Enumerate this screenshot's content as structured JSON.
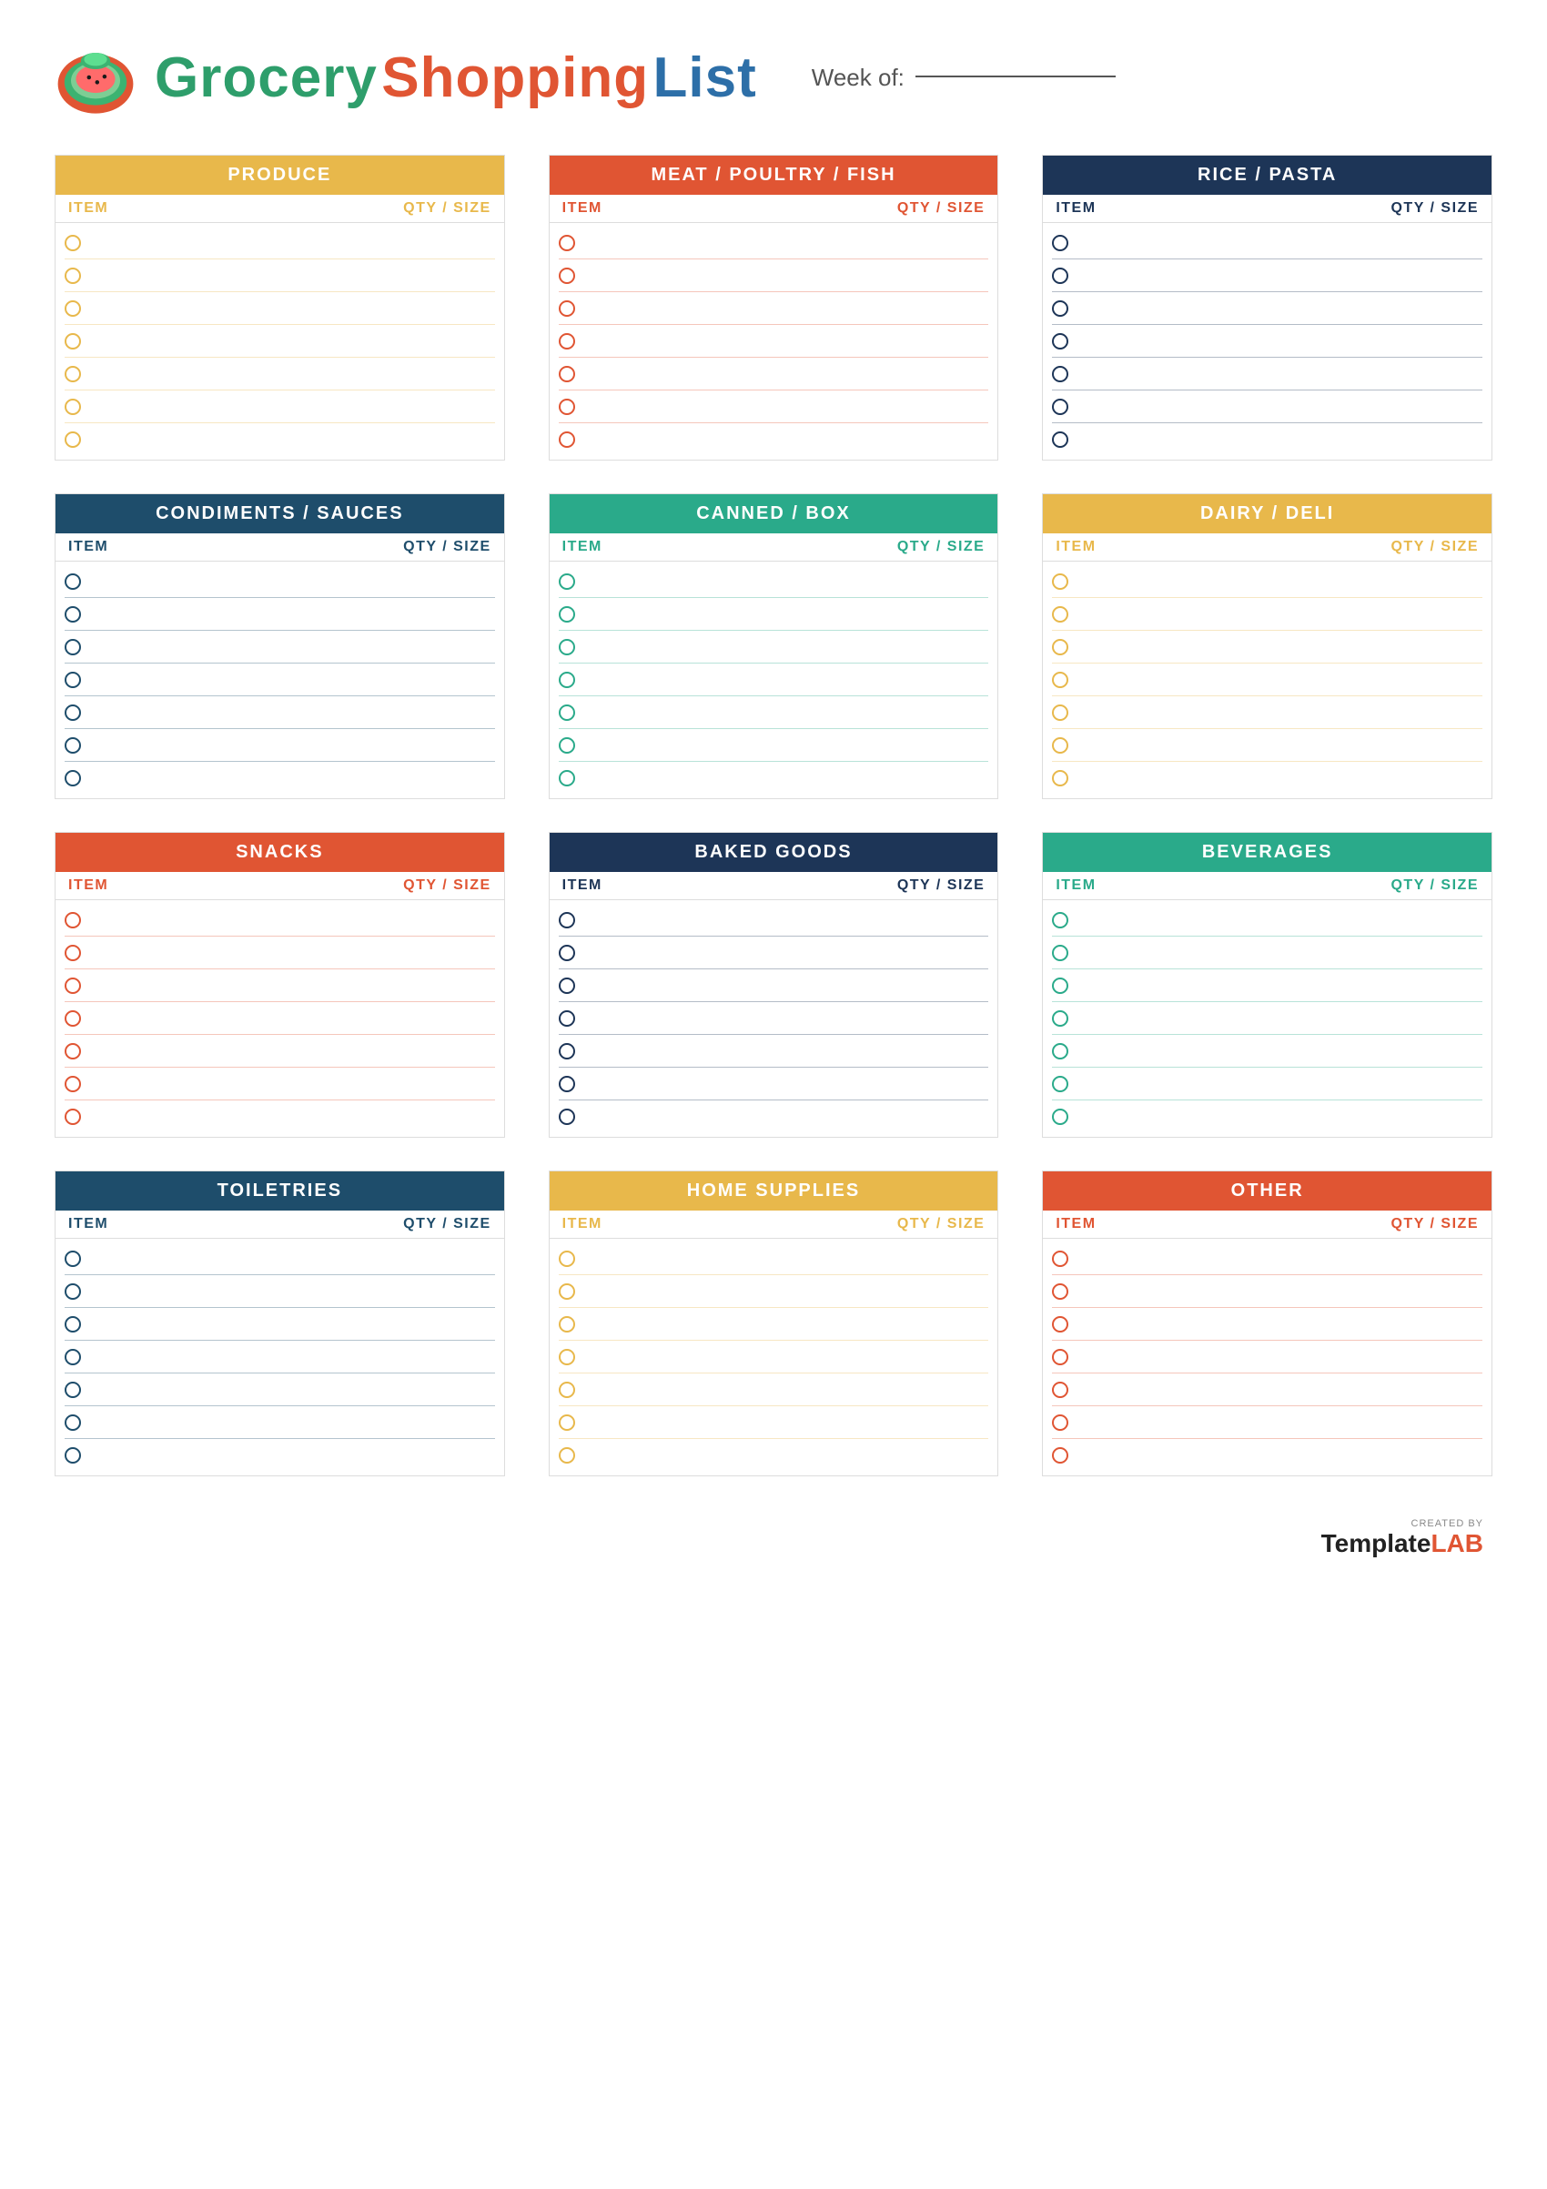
{
  "header": {
    "title_grocery": "Grocery",
    "title_shopping": "Shopping",
    "title_list": "List",
    "week_label": "Week of:"
  },
  "sections": [
    {
      "id": "produce",
      "title": "PRODUCE",
      "theme": "theme-yellow",
      "item_label": "ITEM",
      "qty_label": "QTY / SIZE",
      "rows": 7
    },
    {
      "id": "meat",
      "title": "MEAT / POULTRY / FISH",
      "theme": "theme-red",
      "item_label": "ITEM",
      "qty_label": "QTY / SIZE",
      "rows": 7
    },
    {
      "id": "rice",
      "title": "RICE / PASTA",
      "theme": "theme-darkblue",
      "item_label": "ITEM",
      "qty_label": "QTY / SIZE",
      "rows": 7
    },
    {
      "id": "condiments",
      "title": "CONDIMENTS / SAUCES",
      "theme": "theme-navy",
      "item_label": "ITEM",
      "qty_label": "QTY / SIZE",
      "rows": 7
    },
    {
      "id": "canned",
      "title": "CANNED / BOX",
      "theme": "theme-teal",
      "item_label": "ITEM",
      "qty_label": "QTY / SIZE",
      "rows": 7
    },
    {
      "id": "dairy",
      "title": "DAIRY / DELI",
      "theme": "theme-yellow",
      "item_label": "ITEM",
      "qty_label": "QTY / SIZE",
      "rows": 7
    },
    {
      "id": "snacks",
      "title": "SNACKS",
      "theme": "theme-red",
      "item_label": "ITEM",
      "qty_label": "QTY / SIZE",
      "rows": 7
    },
    {
      "id": "baked",
      "title": "BAKED GOODS",
      "theme": "theme-darkblue",
      "item_label": "ITEM",
      "qty_label": "QTY / SIZE",
      "rows": 7
    },
    {
      "id": "beverages",
      "title": "BEVERAGES",
      "theme": "theme-teal",
      "item_label": "ITEM",
      "qty_label": "QTY / SIZE",
      "rows": 7
    },
    {
      "id": "toiletries",
      "title": "TOILETRIES",
      "theme": "theme-navy",
      "item_label": "ITEM",
      "qty_label": "QTY / SIZE",
      "rows": 7
    },
    {
      "id": "home",
      "title": "HOME SUPPLIES",
      "theme": "theme-yellow",
      "item_label": "ITEM",
      "qty_label": "QTY / SIZE",
      "rows": 7
    },
    {
      "id": "other",
      "title": "OTHER",
      "theme": "theme-red",
      "item_label": "ITEM",
      "qty_label": "QTY / SIZE",
      "rows": 7
    }
  ],
  "footer": {
    "created_by": "CREATED BY",
    "brand": "Template",
    "brand_lab": "LAB"
  }
}
